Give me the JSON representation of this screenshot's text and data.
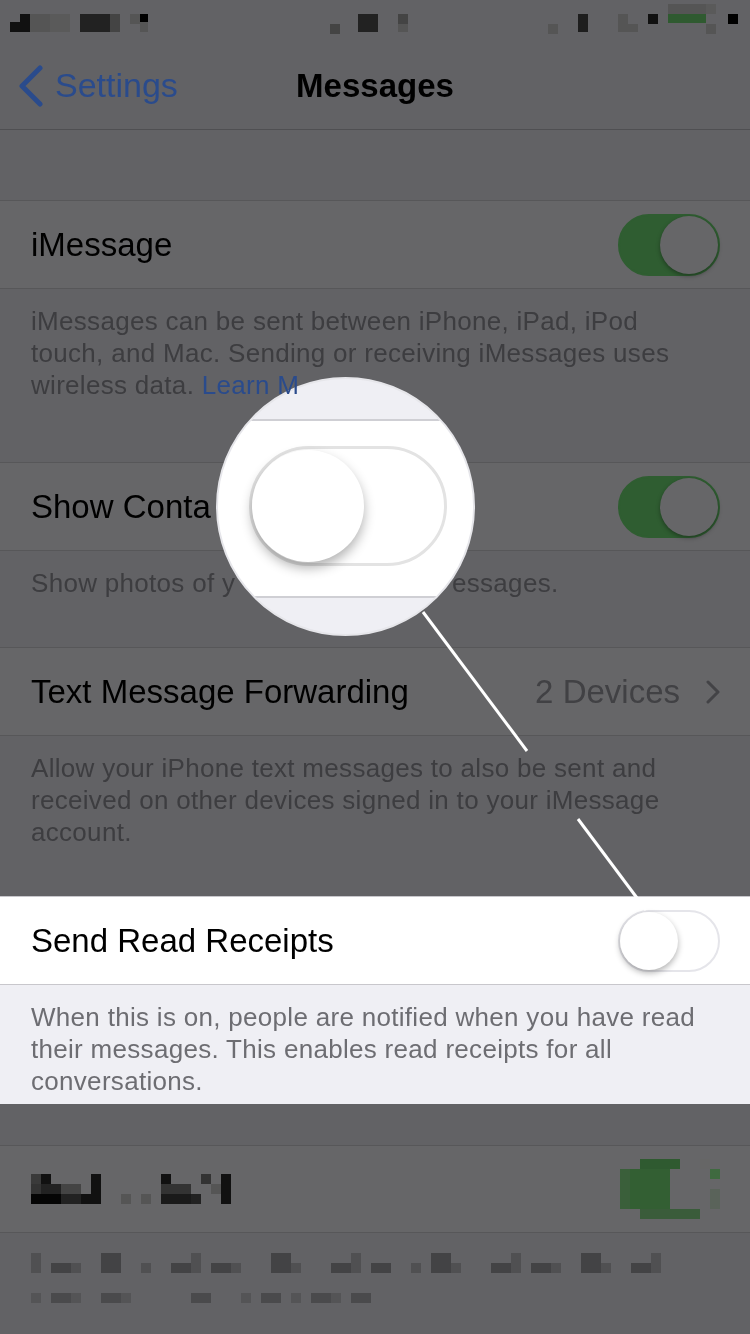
{
  "nav": {
    "back_label": "Settings",
    "title": "Messages"
  },
  "sections": [
    {
      "highlighted": false,
      "row": {
        "kind": "toggle",
        "label": "iMessage",
        "on": true
      },
      "footer": {
        "lines": [
          "iMessages can be sent between iPhone, iPad, iPod",
          "touch, and Mac. Sending or receiving iMessages uses",
          "wireless data."
        ],
        "link": "Learn M"
      }
    },
    {
      "highlighted": false,
      "row": {
        "kind": "toggle",
        "label": "Show Conta",
        "on": true
      },
      "footer": {
        "lines": [
          "Show photos of y"
        ],
        "after_magnifier": "essages."
      }
    },
    {
      "highlighted": false,
      "row": {
        "kind": "detail",
        "label": "Text Message Forwarding",
        "value": "2 Devices"
      },
      "footer": {
        "lines": [
          "Allow your iPhone text messages to also be sent and",
          "received on other devices signed in to your iMessage",
          "account."
        ]
      }
    },
    {
      "highlighted": true,
      "row": {
        "kind": "toggle",
        "label": "Send Read Receipts",
        "on": false
      },
      "footer": {
        "lines": [
          "When this is on, people are notified when you have read",
          "their messages. This enables read receipts for all",
          "conversations."
        ]
      }
    }
  ]
}
